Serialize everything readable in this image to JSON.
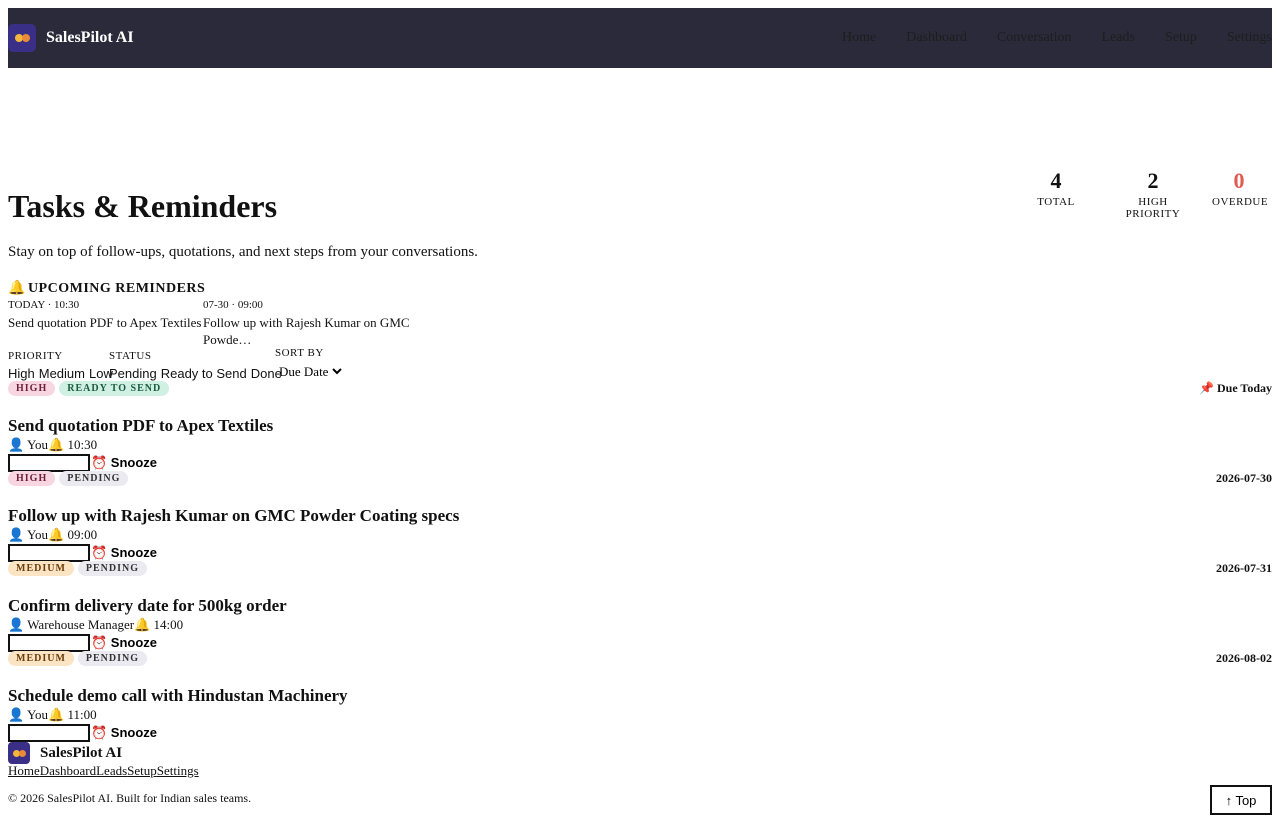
{
  "header": {
    "brand": "SalesPilot AI",
    "nav": [
      "Home",
      "Dashboard",
      "Conversation",
      "Leads",
      "Setup",
      "Settings"
    ]
  },
  "stats": {
    "total": {
      "value": "4",
      "label": "TOTAL"
    },
    "high": {
      "value": "2",
      "label": "HIGH PRIORITY"
    },
    "overdue": {
      "value": "0",
      "label": "OVERDUE"
    }
  },
  "page": {
    "title": "Tasks & Reminders",
    "subtitle": "Stay on top of follow-ups, quotations, and next steps from your conversations."
  },
  "reminders": {
    "heading": "UPCOMING REMINDERS",
    "items": [
      {
        "when": "TODAY · 10:30",
        "text": "Send quotation PDF to Apex Textiles"
      },
      {
        "when": "07-30 · 09:00",
        "text": "Follow up with Rajesh Kumar on GMC Powde…"
      }
    ]
  },
  "filters": {
    "priority_label": "PRIORITY",
    "priority_options": [
      "High",
      "Medium",
      "Low"
    ],
    "status_label": "STATUS",
    "status_options": [
      "Pending",
      "Ready to Send",
      "Done"
    ],
    "sort_label": "SORT BY",
    "sort_value": "Due Date"
  },
  "tasks": [
    {
      "priority": "HIGH",
      "status": "READY TO SEND",
      "due": "📌 Due Today",
      "title": "Send quotation PDF to Apex Textiles",
      "assignee": "👤 You",
      "time": "🔔 10:30",
      "snooze": "⏰ Snooze"
    },
    {
      "priority": "HIGH",
      "status": "PENDING",
      "due": "2026-07-30",
      "title": "Follow up with Rajesh Kumar on GMC Powder Coating specs",
      "assignee": "👤 You",
      "time": "🔔 09:00",
      "snooze": "⏰ Snooze"
    },
    {
      "priority": "MEDIUM",
      "status": "PENDING",
      "due": "2026-07-31",
      "title": "Confirm delivery date for 500kg order",
      "assignee": "👤 Warehouse Manager",
      "time": "🔔 14:00",
      "snooze": "⏰ Snooze"
    },
    {
      "priority": "MEDIUM",
      "status": "PENDING",
      "due": "2026-08-02",
      "title": "Schedule demo call with Hindustan Machinery",
      "assignee": "👤 You",
      "time": "🔔 11:00",
      "snooze": "⏰ Snooze"
    }
  ],
  "footer": {
    "brand": "SalesPilot AI",
    "links": [
      "Home",
      "Dashboard",
      "Leads",
      "Setup",
      "Settings"
    ],
    "copyright": "© 2026 SalesPilot AI. Built for Indian sales teams.",
    "top_button": "↑ Top"
  },
  "colors": {
    "header_bg": "#2b2a3a",
    "logo_bg": "#3a2f86",
    "overdue": "#e05a4f",
    "high_badge": "#f7d6e1",
    "medium_badge": "#fbe4c3",
    "ready_badge": "#cff0e2",
    "pending_badge": "#eaeaf0"
  }
}
